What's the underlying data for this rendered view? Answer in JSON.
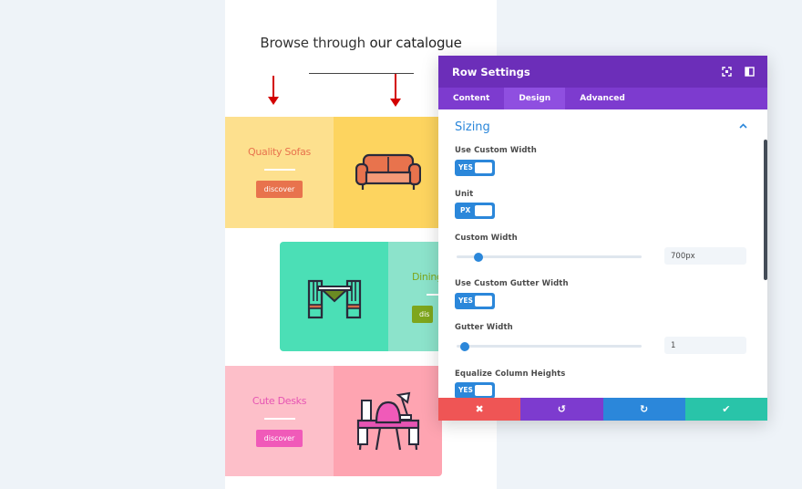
{
  "preview": {
    "headline_plain": "Browse through ",
    "headline_bold": "our catalogue",
    "rows": [
      {
        "title": "Quality Sofas",
        "button": "discover",
        "text_bg": "#fde08e",
        "icon_bg": "#fdd45f",
        "title_color": "#e8734d",
        "btn_color": "#e8734d"
      },
      {
        "title": "Dining",
        "button": "dis",
        "text_bg": "#8ce3cb",
        "icon_bg": "#4bdfb6",
        "title_color": "#7ea61c",
        "btn_color": "#7ea61c"
      },
      {
        "title": "Cute Desks",
        "button": "discover",
        "text_bg": "#fdbfc9",
        "icon_bg": "#fea4b1",
        "title_color": "#e654b3",
        "btn_color": "#f05ab9"
      }
    ],
    "icons": [
      "sofa-icon",
      "dining-table-icon",
      "desk-lamp-chair-icon",
      "arrow-down-icon"
    ]
  },
  "modal": {
    "title": "Row Settings",
    "header_icons": [
      "fullscreen-icon",
      "sidebar-toggle-icon"
    ],
    "tabs": [
      {
        "label": "Content"
      },
      {
        "label": "Design",
        "active": true
      },
      {
        "label": "Advanced"
      }
    ],
    "section_title": "Sizing",
    "fields": {
      "use_custom_width": {
        "label": "Use Custom Width",
        "toggle": "YES"
      },
      "unit": {
        "label": "Unit",
        "toggle": "PX"
      },
      "custom_width": {
        "label": "Custom Width",
        "value": "700px",
        "slider_fraction": 0.1
      },
      "use_custom_gutter": {
        "label": "Use Custom Gutter Width",
        "toggle": "YES"
      },
      "gutter_width": {
        "label": "Gutter Width",
        "value": "1",
        "slider_fraction": 0.02
      },
      "equalize": {
        "label": "Equalize Column Heights",
        "toggle": "YES"
      }
    },
    "footer_buttons": [
      {
        "name": "cancel",
        "icon": "close-icon",
        "glyph": "✖",
        "color": "#ef5555"
      },
      {
        "name": "undo",
        "icon": "undo-icon",
        "glyph": "↺",
        "color": "#7d3bcf"
      },
      {
        "name": "redo",
        "icon": "redo-icon",
        "glyph": "↻",
        "color": "#2b87da"
      },
      {
        "name": "save",
        "icon": "check-icon",
        "glyph": "✔",
        "color": "#29c4a9"
      }
    ],
    "accent": "#2b87da",
    "header_color": "#6c2eb9"
  }
}
